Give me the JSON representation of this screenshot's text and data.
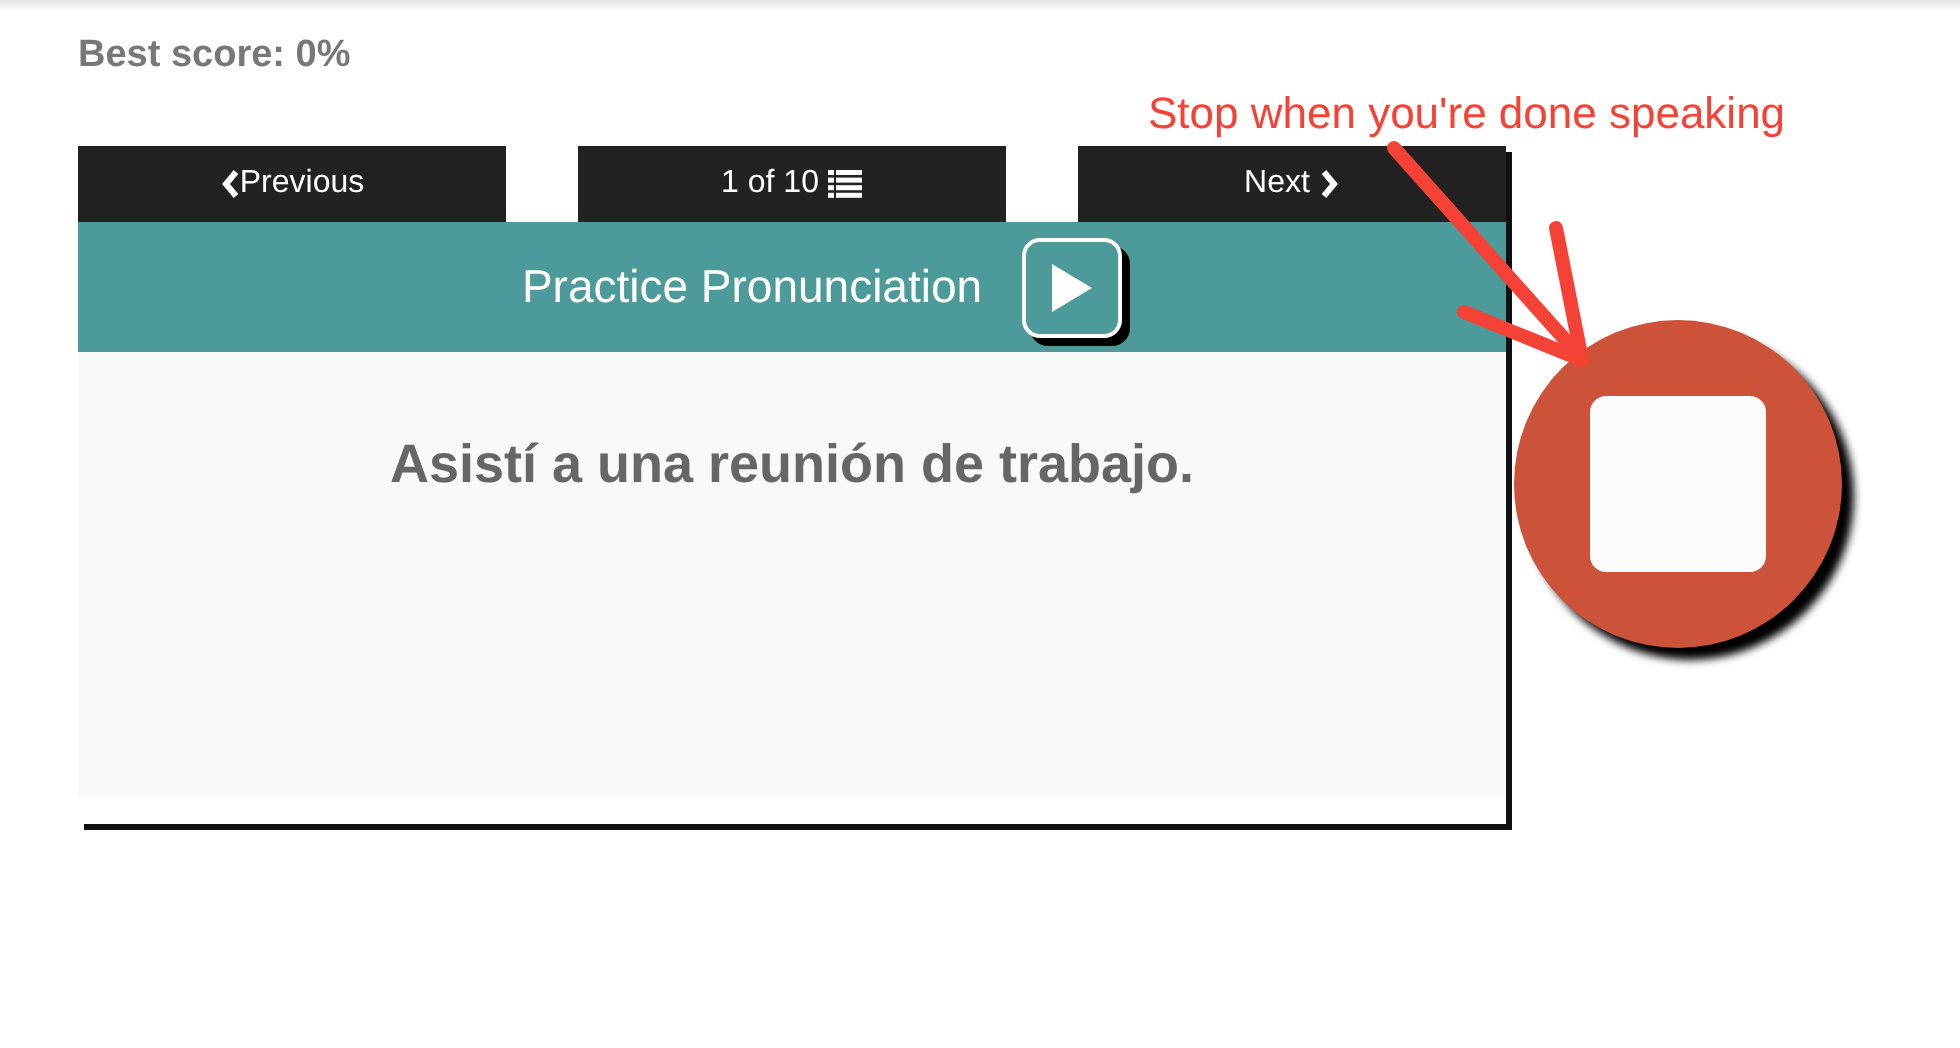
{
  "best_score": "Best score: 0%",
  "annotation": "Stop when you're done speaking",
  "nav": {
    "previous": "Previous",
    "position": "1 of 10",
    "next": "Next"
  },
  "header": {
    "title": "Practice Pronunciation"
  },
  "sentence": "Asistí a una reunión de trabajo.",
  "recording": true
}
